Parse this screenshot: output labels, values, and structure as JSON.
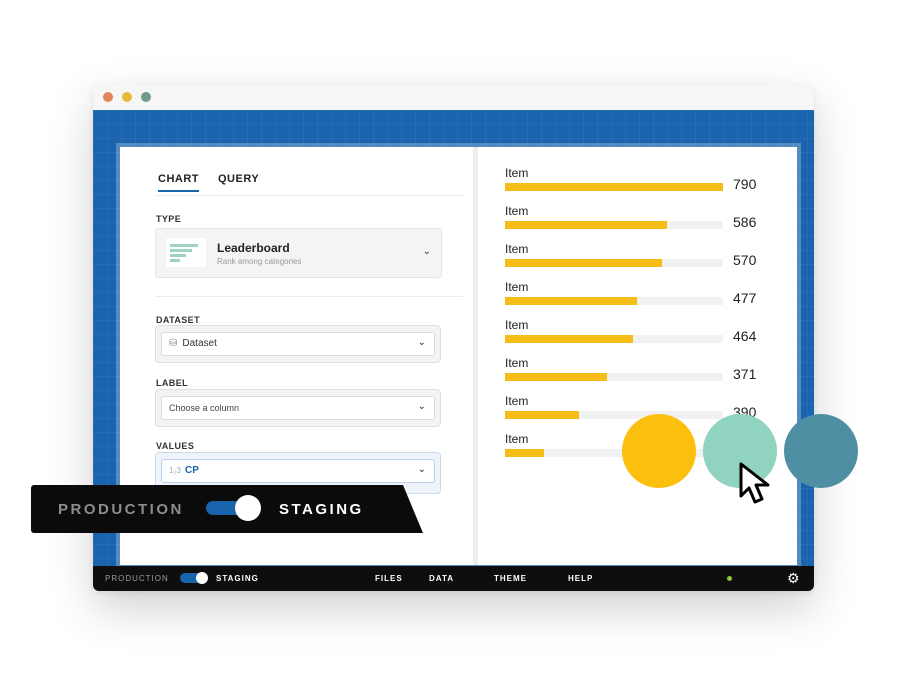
{
  "colors": {
    "accent_blue": "#1a63ad",
    "bar_yellow": "#f6bd16",
    "swatch_1": "#fcbf0d",
    "swatch_2": "#8fd3c0",
    "swatch_3": "#4f8fa3"
  },
  "editor": {
    "tabs": [
      {
        "label": "CHART",
        "active": true
      },
      {
        "label": "QUERY",
        "active": false
      }
    ],
    "type_label": "TYPE",
    "type": {
      "title": "Leaderboard",
      "subtitle": "Rank among categories",
      "icon": "leaderboard-icon"
    },
    "dataset_label": "DATASET",
    "dataset_value": "Dataset",
    "label_label": "LABEL",
    "label_placeholder": "Choose a column",
    "values_label": "VALUES",
    "values_icon_text": "1₂3",
    "values_value": "CP"
  },
  "leaderboard": {
    "items": [
      {
        "label": "Item",
        "value": "790",
        "fraction": 1.0
      },
      {
        "label": "Item",
        "value": "586",
        "fraction": 0.7418
      },
      {
        "label": "Item",
        "value": "570",
        "fraction": 0.7215
      },
      {
        "label": "Item",
        "value": "477",
        "fraction": 0.6038
      },
      {
        "label": "Item",
        "value": "464",
        "fraction": 0.5873
      },
      {
        "label": "Item",
        "value": "371",
        "fraction": 0.4696
      },
      {
        "label": "Item",
        "value": "390",
        "fraction": 0.34
      },
      {
        "label": "Item",
        "value": "",
        "fraction": 0.18
      }
    ]
  },
  "bottombar": {
    "production": "PRODUCTION",
    "staging": "STAGING",
    "menu": [
      "FILES",
      "DATA",
      "THEME",
      "HELP"
    ]
  },
  "banner": {
    "production": "PRODUCTION",
    "staging": "STAGING"
  }
}
